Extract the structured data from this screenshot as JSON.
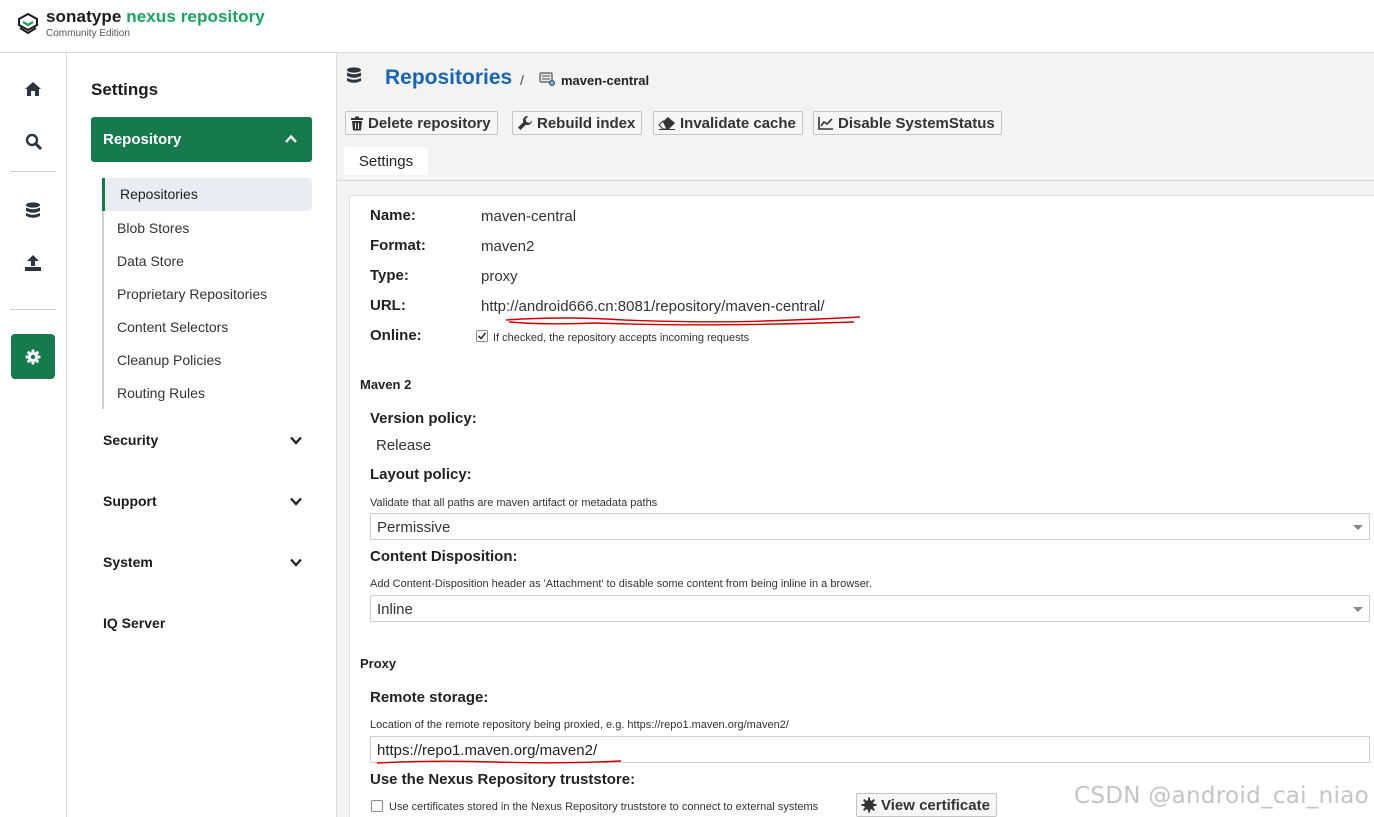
{
  "header": {
    "brand_primary": "sonatype",
    "brand_secondary": "nexus repository",
    "edition": "Community Edition"
  },
  "rail": {
    "icons": [
      "home-icon",
      "search-icon",
      "database-icon",
      "upload-icon",
      "gear-icon"
    ]
  },
  "sidebar": {
    "title": "Settings",
    "repository_section": "Repository",
    "repository_items": [
      "Repositories",
      "Blob Stores",
      "Data Store",
      "Proprietary Repositories",
      "Content Selectors",
      "Cleanup Policies",
      "Routing Rules"
    ],
    "active_item": "Repositories",
    "sections": [
      "Security",
      "Support",
      "System",
      "IQ Server"
    ]
  },
  "breadcrumb": {
    "title": "Repositories",
    "separator": "/",
    "current": "maven-central"
  },
  "toolbar": {
    "delete": "Delete repository",
    "rebuild": "Rebuild index",
    "invalidate": "Invalidate cache",
    "disable": "Disable SystemStatus"
  },
  "tabs": {
    "settings": "Settings"
  },
  "details": {
    "name_label": "Name:",
    "name_value": "maven-central",
    "format_label": "Format:",
    "format_value": "maven2",
    "type_label": "Type:",
    "type_value": "proxy",
    "url_label": "URL:",
    "url_value": "http://android666.cn:8081/repository/maven-central/",
    "online_label": "Online:",
    "online_text": "If checked, the repository accepts incoming requests",
    "online_checked": true
  },
  "maven": {
    "group_title": "Maven 2",
    "version_label": "Version policy:",
    "version_value": "Release",
    "layout_label": "Layout policy:",
    "layout_help": "Validate that all paths are maven artifact or metadata paths",
    "layout_value": "Permissive",
    "disposition_label": "Content Disposition:",
    "disposition_help": "Add Content-Disposition header as 'Attachment' to disable some content from being inline in a browser.",
    "disposition_value": "Inline"
  },
  "proxy": {
    "group_title": "Proxy",
    "remote_label": "Remote storage:",
    "remote_help": "Location of the remote repository being proxied, e.g. https://repo1.maven.org/maven2/",
    "remote_value": "https://repo1.maven.org/maven2/",
    "truststore_label": "Use the Nexus Repository truststore:",
    "truststore_text": "Use certificates stored in the Nexus Repository truststore to connect to external systems",
    "truststore_checked": false,
    "view_certificate": "View certificate"
  },
  "watermark": "CSDN @android_cai_niao",
  "colors": {
    "brand_green": "#1aa260",
    "active_green": "#167a4d",
    "title_blue": "#1865b8",
    "annotation_red": "#d10000"
  }
}
